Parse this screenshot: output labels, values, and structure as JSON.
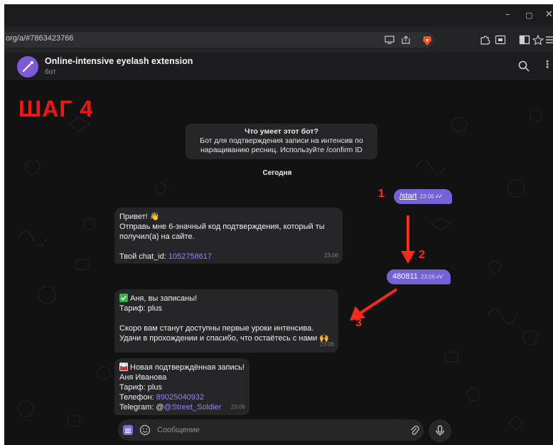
{
  "browser": {
    "url": "org/a/#7863423766",
    "window_controls": [
      "–",
      "▢",
      "✕"
    ]
  },
  "chat_header": {
    "title": "Online-intensive eyelash extension",
    "subtitle": "бот",
    "more": "⋮"
  },
  "overlay": {
    "step_title": "ШАГ 4",
    "markers": [
      "1",
      "2",
      "3"
    ],
    "marker_color": "#ff2a1a"
  },
  "bot_info": {
    "title": "Что умеет этот бот?",
    "line1": "Бот для подтверждения записи на интенсив по",
    "line2": "наращиванию ресниц. Используйте /confirm ID"
  },
  "date_label": "Сегодня",
  "messages": {
    "m1": {
      "text": "/start",
      "time": "23:06",
      "ticks": "✓✓"
    },
    "m2": {
      "line1": "Привет! 👋",
      "line2": "Отправь мне 6-значный код подтверждения, который ты",
      "line3": "получил(а) на сайте.",
      "chat_id_label": "Твой chat_id: ",
      "chat_id": "1052758617",
      "time": "23:06"
    },
    "m3": {
      "text": "480811",
      "time": "23:06",
      "ticks": "✓✓"
    },
    "m4": {
      "line1": "Аня, вы записаны!",
      "line2": "Тариф: plus",
      "line3": "Скоро вам станут доступны первые уроки интенсива.",
      "line4": "Удачи в прохождении и спасибо, что остаётесь с нами 🙌",
      "time": "23:06"
    },
    "m5": {
      "line1": "Новая подтверждённая запись!",
      "line2": "Аня Иванова",
      "line3": "Тариф: plus",
      "phone_label": "Телефон: ",
      "phone": "89025040932",
      "telegram_label": "Telegram: @",
      "telegram": "@Street_Soldier",
      "time": "23:06"
    }
  },
  "composer": {
    "placeholder": "Сообщение"
  },
  "colors": {
    "accent": "#7264d6",
    "link": "#8e84ff",
    "bubble_in": "#262628",
    "background": "#121213"
  },
  "icons": [
    "brave-lion-icon",
    "search-icon",
    "emoji-icon",
    "attach-icon",
    "mic-icon",
    "menu-icon",
    "avatar-icon"
  ]
}
